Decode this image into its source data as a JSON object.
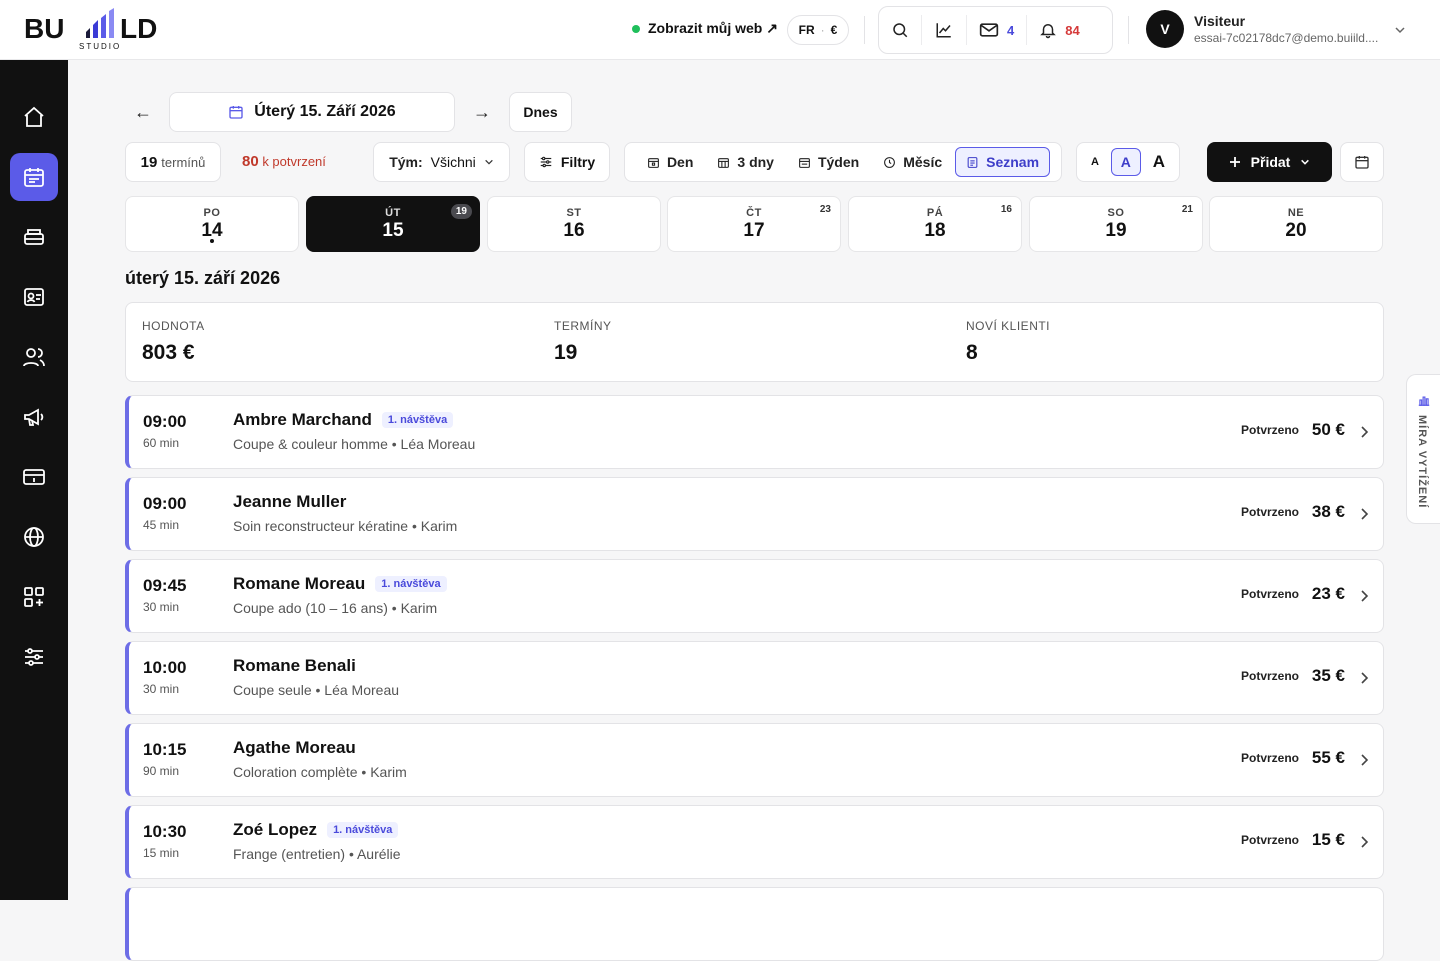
{
  "brand": {
    "logo_text": "BUILD",
    "logo_sub": "STUDIO",
    "accent": "#5b5be8"
  },
  "header": {
    "site_link": "Zobrazit můj web ↗",
    "lang": "FR",
    "currency": "€",
    "mail_count": "4",
    "notif_count": "84",
    "user": {
      "initial": "V",
      "name": "Visiteur",
      "email": "essai-7c02178dc7@demo.buiild...."
    }
  },
  "sidebar": {
    "items": [
      {
        "name": "home-icon",
        "active": false
      },
      {
        "name": "calendar-icon",
        "active": true
      },
      {
        "name": "register-icon",
        "active": false
      },
      {
        "name": "contact-card-icon",
        "active": false
      },
      {
        "name": "users-icon",
        "active": false
      },
      {
        "name": "megaphone-icon",
        "active": false
      },
      {
        "name": "payment-card-icon",
        "active": false
      },
      {
        "name": "globe-icon",
        "active": false
      },
      {
        "name": "apps-icon",
        "active": false
      },
      {
        "name": "sliders-icon",
        "active": false
      }
    ]
  },
  "toolbar": {
    "date_label": "Úterý 15. Září 2026",
    "today_label": "Dnes",
    "count": "19",
    "count_label": "termínů",
    "pending": "80",
    "pending_label": "k potvrzení",
    "team_key": "Tým:",
    "team_value": "Všichni",
    "filters_label": "Filtry",
    "views": [
      {
        "label": "Den",
        "icon": "calendar-day-icon",
        "active": false
      },
      {
        "label": "3 dny",
        "icon": "calendar-3day-icon",
        "active": false
      },
      {
        "label": "Týden",
        "icon": "calendar-week-icon",
        "active": false
      },
      {
        "label": "Měsíc",
        "icon": "clock-icon",
        "active": false
      },
      {
        "label": "Seznam",
        "icon": "list-icon",
        "active": true
      }
    ],
    "font_sizes": [
      "A",
      "A",
      "A"
    ],
    "add_label": "Přidat"
  },
  "days": [
    {
      "name": "PO",
      "num": "14",
      "count": "",
      "selected": false,
      "dot": true
    },
    {
      "name": "ÚT",
      "num": "15",
      "count": "19",
      "selected": true,
      "dot": false
    },
    {
      "name": "ST",
      "num": "16",
      "count": "",
      "selected": false,
      "dot": false
    },
    {
      "name": "ČT",
      "num": "17",
      "count": "23",
      "selected": false,
      "dot": false
    },
    {
      "name": "PÁ",
      "num": "18",
      "count": "16",
      "selected": false,
      "dot": false
    },
    {
      "name": "SO",
      "num": "19",
      "count": "21",
      "selected": false,
      "dot": false
    },
    {
      "name": "NE",
      "num": "20",
      "count": "",
      "selected": false,
      "dot": false
    }
  ],
  "day_heading": "úterý 15. září 2026",
  "summary": [
    {
      "label": "HODNOTA",
      "value": "803 €"
    },
    {
      "label": "TERMÍNY",
      "value": "19"
    },
    {
      "label": "NOVÍ KLIENTI",
      "value": "8"
    }
  ],
  "appointments": [
    {
      "time": "09:00",
      "duration": "60 min",
      "client": "Ambre Marchand",
      "badge": "1. návštěva",
      "service": "Coupe & couleur homme • Léa Moreau",
      "status": "Potvrzeno",
      "price": "50 €"
    },
    {
      "time": "09:00",
      "duration": "45 min",
      "client": "Jeanne Muller",
      "badge": "",
      "service": "Soin reconstructeur kératine • Karim",
      "status": "Potvrzeno",
      "price": "38 €"
    },
    {
      "time": "09:45",
      "duration": "30 min",
      "client": "Romane Moreau",
      "badge": "1. návštěva",
      "service": "Coupe ado (10 – 16 ans) • Karim",
      "status": "Potvrzeno",
      "price": "23 €"
    },
    {
      "time": "10:00",
      "duration": "30 min",
      "client": "Romane Benali",
      "badge": "",
      "service": "Coupe seule • Léa Moreau",
      "status": "Potvrzeno",
      "price": "35 €"
    },
    {
      "time": "10:15",
      "duration": "90 min",
      "client": "Agathe Moreau",
      "badge": "",
      "service": "Coloration complète • Karim",
      "status": "Potvrzeno",
      "price": "55 €"
    },
    {
      "time": "10:30",
      "duration": "15 min",
      "client": "Zoé Lopez",
      "badge": "1. návštěva",
      "service": "Frange (entretien) • Aurélie",
      "status": "Potvrzeno",
      "price": "15 €"
    }
  ],
  "side_tab": "MÍRA VYTÍŽENÍ"
}
